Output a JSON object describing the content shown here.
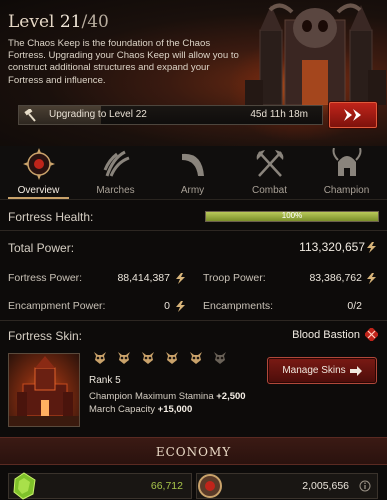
{
  "header": {
    "level_label": "Level",
    "level_current": "21",
    "level_max": "/40",
    "description": "The Chaos Keep is the foundation of the Chaos Fortress. Upgrading your Chaos Keep will allow you to construct additional structures and expand your Fortress and influence.",
    "upgrade_label": "Upgrading to Level 22",
    "upgrade_time": "45d 11h 18m",
    "upgrade_progress": 0.27
  },
  "tabs": [
    {
      "label": "Overview",
      "active": true
    },
    {
      "label": "Marches",
      "active": false
    },
    {
      "label": "Army",
      "active": false
    },
    {
      "label": "Combat",
      "active": false
    },
    {
      "label": "Champion",
      "active": false
    }
  ],
  "health": {
    "label": "Fortress Health:",
    "percent_text": "100%",
    "percent": 1.0
  },
  "total_power": {
    "label": "Total Power:",
    "value": "113,320,657"
  },
  "stats": {
    "fortress_power": {
      "label": "Fortress Power:",
      "value": "88,414,387"
    },
    "troop_power": {
      "label": "Troop Power:",
      "value": "83,386,762"
    },
    "encampment_power": {
      "label": "Encampment Power:",
      "value": "0"
    },
    "encampments": {
      "label": "Encampments:",
      "value": "0/2"
    }
  },
  "skin": {
    "label": "Fortress Skin:",
    "name": "Blood Bastion",
    "rank": "Rank 5",
    "rank_level": 5,
    "rank_max": 6,
    "bonus1_label": "Champion Maximum Stamina",
    "bonus1_value": "+2,500",
    "bonus2_label": "March Capacity",
    "bonus2_value": "+15,000",
    "manage_label": "Manage Skins"
  },
  "economy": {
    "title": "ECONOMY",
    "resource1_value": "66,712",
    "resource2_value": "2,005,656"
  },
  "colors": {
    "accent_red": "#c0241a",
    "health_green": "#9fb13f",
    "resource1_text": "#a8c64a"
  },
  "icons": {
    "upgrade": "hammer-icon",
    "speedup": "double-arrow-icon",
    "power": "power-bolt-icon",
    "skin_marker": "red-sigil-icon",
    "rank": "skull-rank-icon",
    "resource1": "warpstone-icon",
    "resource2": "coin-icon",
    "resource2_info": "info-icon"
  }
}
